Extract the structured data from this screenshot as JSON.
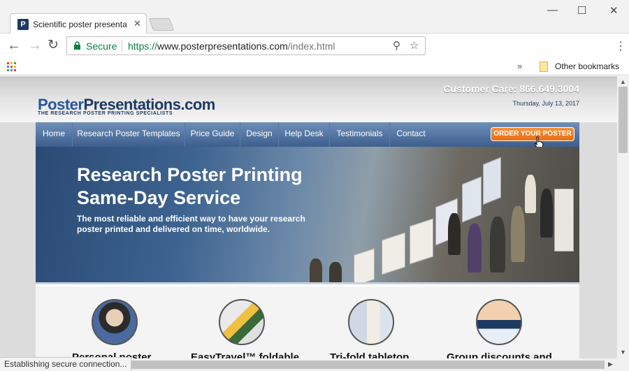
{
  "browser": {
    "tab_title": "Scientific poster presenta",
    "tab_favicon": "P",
    "secure_label": "Secure",
    "url_scheme": "https://",
    "url_host": "www.posterpresentations.com",
    "url_path": "/index.html",
    "other_bookmarks": "Other bookmarks",
    "status_text": "Establishing secure connection..."
  },
  "site": {
    "customer_care": "Customer Care: 866.649.3004",
    "logo_text_a": "Poster",
    "logo_text_b": "Presentations.com",
    "logo_tagline": "THE RESEARCH POSTER PRINTING SPECIALISTS",
    "date": "Thursday, July 13, 2017",
    "nav": [
      {
        "label": "Home"
      },
      {
        "label": "Research Poster Templates"
      },
      {
        "label": "Price Guide"
      },
      {
        "label": "Design"
      },
      {
        "label": "Help Desk"
      },
      {
        "label": "Testimonials"
      },
      {
        "label": "Contact"
      }
    ],
    "order_button": "ORDER YOUR POSTER",
    "hero_title_line1": "Research Poster Printing",
    "hero_title_line2": "Same-Day Service",
    "hero_subtitle": "The most reliable and efficient way to have your research poster printed and delivered on time, worldwide.",
    "features": [
      {
        "title": "Personal poster"
      },
      {
        "title": "EasyTravel™ foldable"
      },
      {
        "title": "Tri-fold tabletop"
      },
      {
        "title": "Group discounts and"
      }
    ]
  },
  "colors": {
    "brand_navy": "#1d3a63",
    "nav_blue": "#3d5f8e",
    "order_orange": "#f7913c",
    "secure_green": "#0b8043"
  }
}
